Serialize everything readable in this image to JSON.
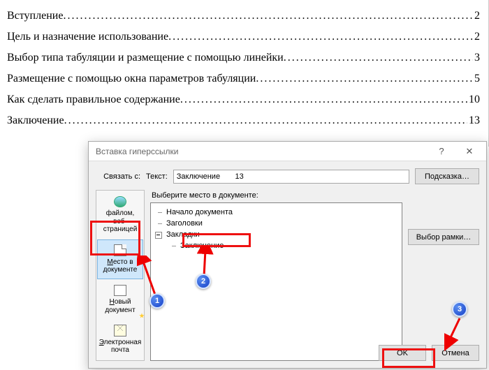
{
  "toc": {
    "items": [
      {
        "title": "Вступление",
        "page": "2"
      },
      {
        "title": "Цель и назначение использование",
        "page": "2"
      },
      {
        "title": "Выбор типа табуляции и размещение с помощью линейки",
        "page": "3"
      },
      {
        "title": "Размещение с помощью окна параметров табуляции",
        "page": "5"
      },
      {
        "title": "Как сделать правильное содержание",
        "page": "10"
      },
      {
        "title": "Заключение",
        "page": "13"
      }
    ]
  },
  "dialog": {
    "title": "Вставка гиперссылки",
    "help_symbol": "?",
    "close_symbol": "✕",
    "link_with_label": "Связать с:",
    "text_label": "Текст:",
    "text_value": "Заключение       13",
    "hint_button": "Подсказка…",
    "select_place_label": "Выберите место в документе:",
    "frame_button": "Выбор рамки…",
    "ok": "OK",
    "cancel": "Отмена",
    "categories": {
      "file_web": "файлом, веб-страницей",
      "place_doc_prefix": "М",
      "place_doc_rest": "есто в документе",
      "new_doc_prefix": "Н",
      "new_doc_rest": "овый документ",
      "email_prefix": "Э",
      "email_rest": "лектронная почта"
    },
    "tree": {
      "start": "Начало документа",
      "headings": "Заголовки",
      "bookmarks": "Закладки",
      "bookmark_child": "Заключение"
    }
  },
  "badges": {
    "b1": "1",
    "b2": "2",
    "b3": "3"
  }
}
